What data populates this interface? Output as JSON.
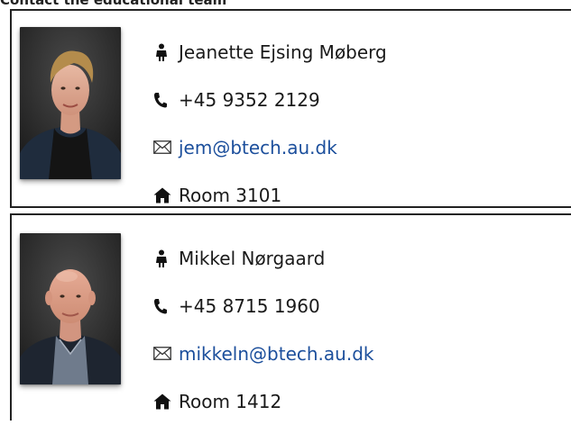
{
  "header": {
    "title": "Contact the educational team"
  },
  "contacts": [
    {
      "name": "Jeanette Ejsing Møberg",
      "phone": "+45 9352 2129",
      "email": "jem@btech.au.dk",
      "room": "Room 3101",
      "photo_desc": "woman-portrait"
    },
    {
      "name": "Mikkel Nørgaard",
      "phone": "+45 8715 1960",
      "email": "mikkeln@btech.au.dk",
      "room": "Room 1412",
      "photo_desc": "man-portrait"
    }
  ],
  "icons": {
    "person": "person-icon",
    "phone": "phone-icon",
    "email": "envelope-icon",
    "room": "home-icon"
  },
  "colors": {
    "link": "#1c4f9c",
    "border": "#222222"
  }
}
